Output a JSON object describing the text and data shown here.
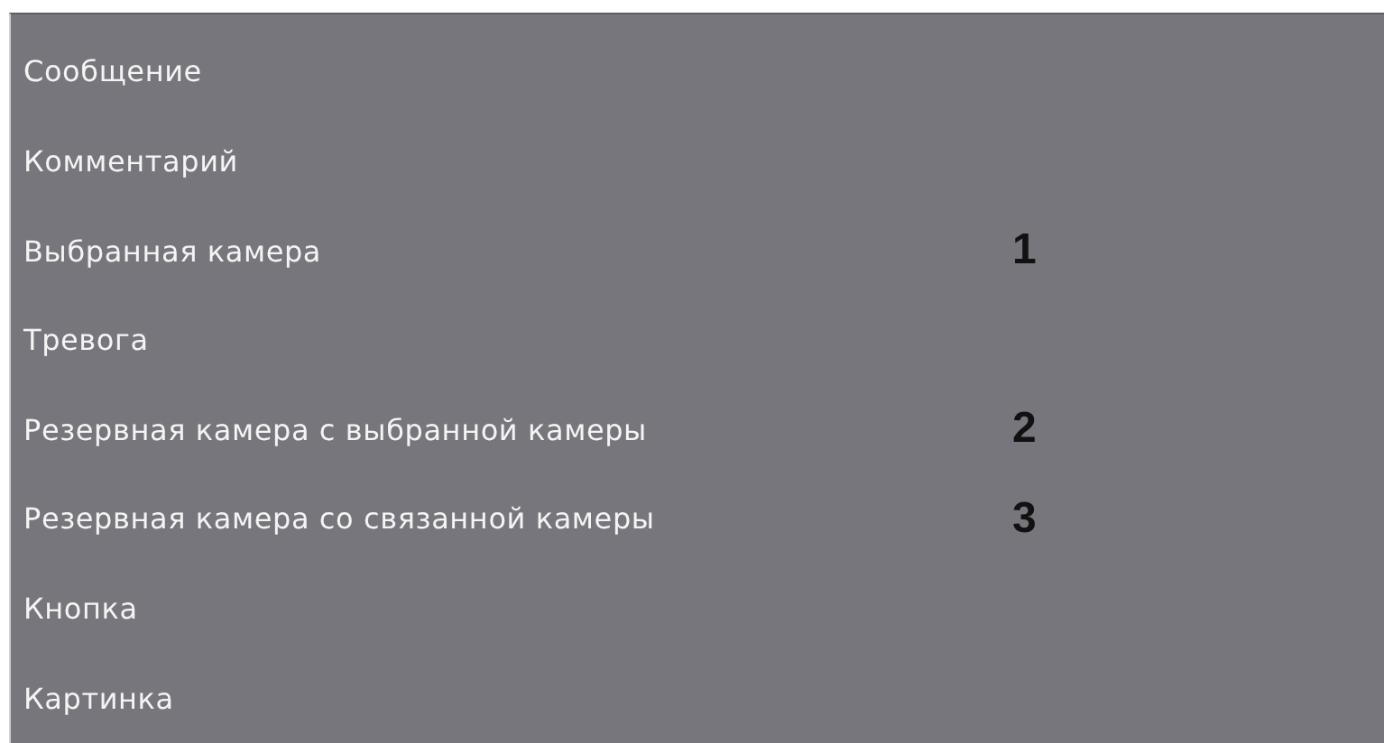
{
  "menu": {
    "items": [
      {
        "label": "Сообщение"
      },
      {
        "label": "Комментарий"
      },
      {
        "label": "Выбранная камера",
        "marker": "1"
      },
      {
        "label": "Тревога"
      },
      {
        "label": "Резервная камера с выбранной камеры",
        "marker": "2"
      },
      {
        "label": "Резервная камера со связанной камеры",
        "marker": "3"
      },
      {
        "label": "Кнопка"
      },
      {
        "label": "Картинка"
      }
    ]
  }
}
